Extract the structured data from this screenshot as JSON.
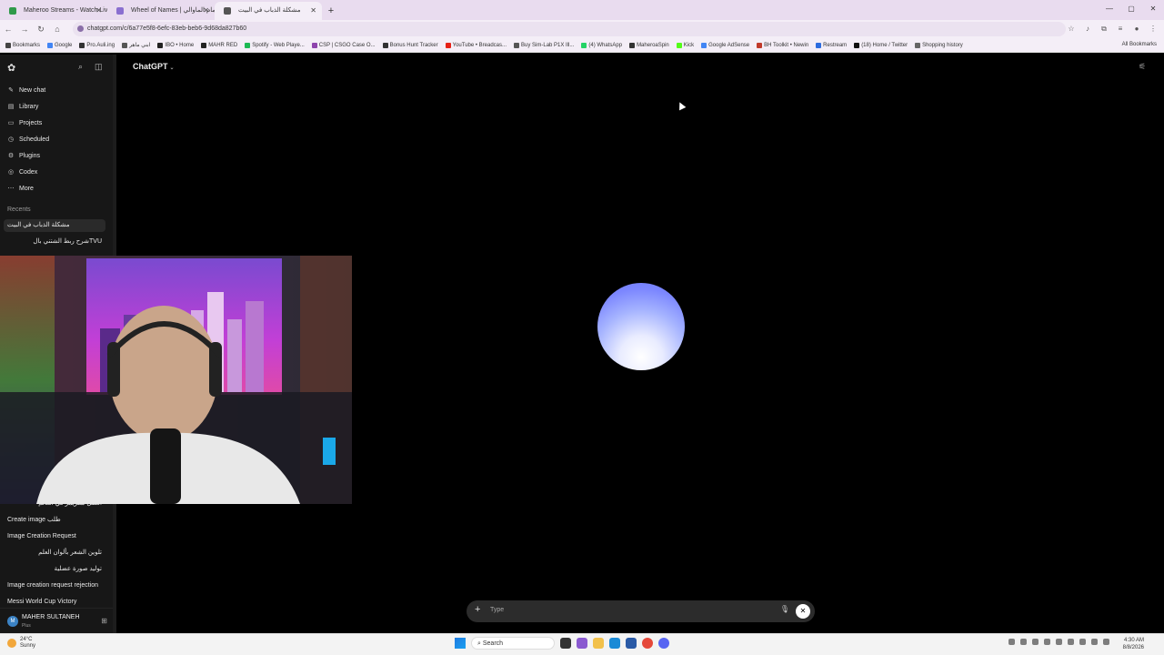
{
  "browser": {
    "tabs": [
      {
        "title": "Maheroo Streams - Watch Live o",
        "color": "#2f9a4a",
        "active": false
      },
      {
        "title": "Wheel of Names | أمام الماوالي",
        "color": "#8a6fd0",
        "active": false
      },
      {
        "title": "مشكلة الذباب في البيت",
        "color": "#555555",
        "active": true
      }
    ],
    "url": "chatgpt.com/c/6a77e5f8-6efc-83eb-beb6-9d68da827b60",
    "bookmarks": [
      {
        "label": "Bookmarks",
        "color": "#444444"
      },
      {
        "label": "Google",
        "color": "#4285f4"
      },
      {
        "label": "Pro.Auli.ing",
        "color": "#333333"
      },
      {
        "label": "ابني ماهر",
        "color": "#555555"
      },
      {
        "label": "IBO • Home",
        "color": "#222222"
      },
      {
        "label": "MAHR RED",
        "color": "#222222"
      },
      {
        "label": "Spotify - Web Playe...",
        "color": "#1db954"
      },
      {
        "label": "CSP | CSGO Case O...",
        "color": "#8e44ad"
      },
      {
        "label": "Bonus Hunt Tracker",
        "color": "#333333"
      },
      {
        "label": "YouTube • Breadcas...",
        "color": "#e62117"
      },
      {
        "label": "Buy Sim-Lab P1X Ill...",
        "color": "#555555"
      },
      {
        "label": "(4) WhatsApp",
        "color": "#25d366"
      },
      {
        "label": "MaheroaSpin",
        "color": "#333333"
      },
      {
        "label": "Kick",
        "color": "#53fc18"
      },
      {
        "label": "Google AdSense",
        "color": "#4285f4"
      },
      {
        "label": "BH Toolkit • Newin",
        "color": "#c0392b"
      },
      {
        "label": "Restream",
        "color": "#2d6cdf"
      },
      {
        "label": "(18) Home / Twitter",
        "color": "#111111"
      },
      {
        "label": "Shopping history",
        "color": "#666666"
      }
    ],
    "all_bookmarks": "All Bookmarks"
  },
  "sidebar": {
    "nav": [
      {
        "label": "New chat",
        "icon": "✎"
      },
      {
        "label": "Library",
        "icon": "▤"
      },
      {
        "label": "Projects",
        "icon": "▭"
      },
      {
        "label": "Scheduled",
        "icon": "◷"
      },
      {
        "label": "Plugins",
        "icon": "⚙"
      },
      {
        "label": "Codex",
        "icon": "◎"
      },
      {
        "label": "More",
        "icon": "⋯"
      }
    ],
    "recents_heading": "Recents",
    "recents_top": [
      {
        "label": "مشكلة الذباب في البيت",
        "rtl": false,
        "selected": true
      },
      {
        "label": "شرح ربط الشتني بالTVU",
        "rtl": true,
        "selected": false
      }
    ],
    "recents_bottom": [
      {
        "label": "افضل ستريمر في العالم",
        "rtl": true
      },
      {
        "label": "Create image طلب",
        "rtl": false
      },
      {
        "label": "Image Creation Request",
        "rtl": false
      },
      {
        "label": "تلوين الشعر بألوان العلم",
        "rtl": true
      },
      {
        "label": "توليد صورة عضلية",
        "rtl": true
      },
      {
        "label": "Image creation request rejection",
        "rtl": false
      },
      {
        "label": "Messi World Cup Victory",
        "rtl": false
      }
    ],
    "user": {
      "initials": "M",
      "name": "MAHER SULTANEH",
      "plan": "Plus"
    }
  },
  "main": {
    "title": "ChatGPT",
    "voice": {
      "placeholder": "Type"
    }
  },
  "taskbar": {
    "weather_temp": "24°C",
    "weather_cond": "Sunny",
    "search": "Search",
    "time": "4:30 AM",
    "date": "8/8/2026"
  }
}
